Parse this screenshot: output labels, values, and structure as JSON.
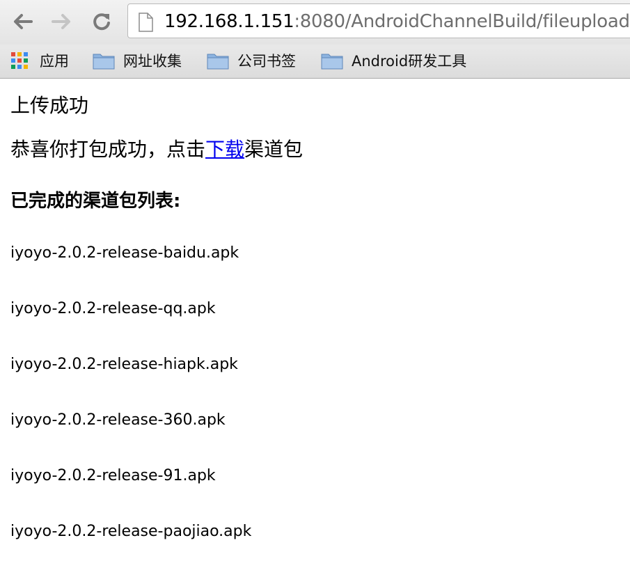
{
  "browser": {
    "url_host": "192.168.1.151",
    "url_rest": ":8080/AndroidChannelBuild/fileupload",
    "bookmarks": [
      {
        "label": "应用",
        "icon": "apps-grid-icon"
      },
      {
        "label": "网址收集",
        "icon": "folder-icon"
      },
      {
        "label": "公司书签",
        "icon": "folder-icon"
      },
      {
        "label": "Android研发工具",
        "icon": "folder-icon"
      }
    ]
  },
  "page": {
    "title": "上传成功",
    "message_prefix": "恭喜你打包成功，点击",
    "download_link": "下载",
    "message_suffix": "渠道包",
    "list_heading": "已完成的渠道包列表:",
    "apk_files": [
      "iyoyo-2.0.2-release-baidu.apk",
      "iyoyo-2.0.2-release-qq.apk",
      "iyoyo-2.0.2-release-hiapk.apk",
      "iyoyo-2.0.2-release-360.apk",
      "iyoyo-2.0.2-release-91.apk",
      "iyoyo-2.0.2-release-paojiao.apk"
    ]
  }
}
